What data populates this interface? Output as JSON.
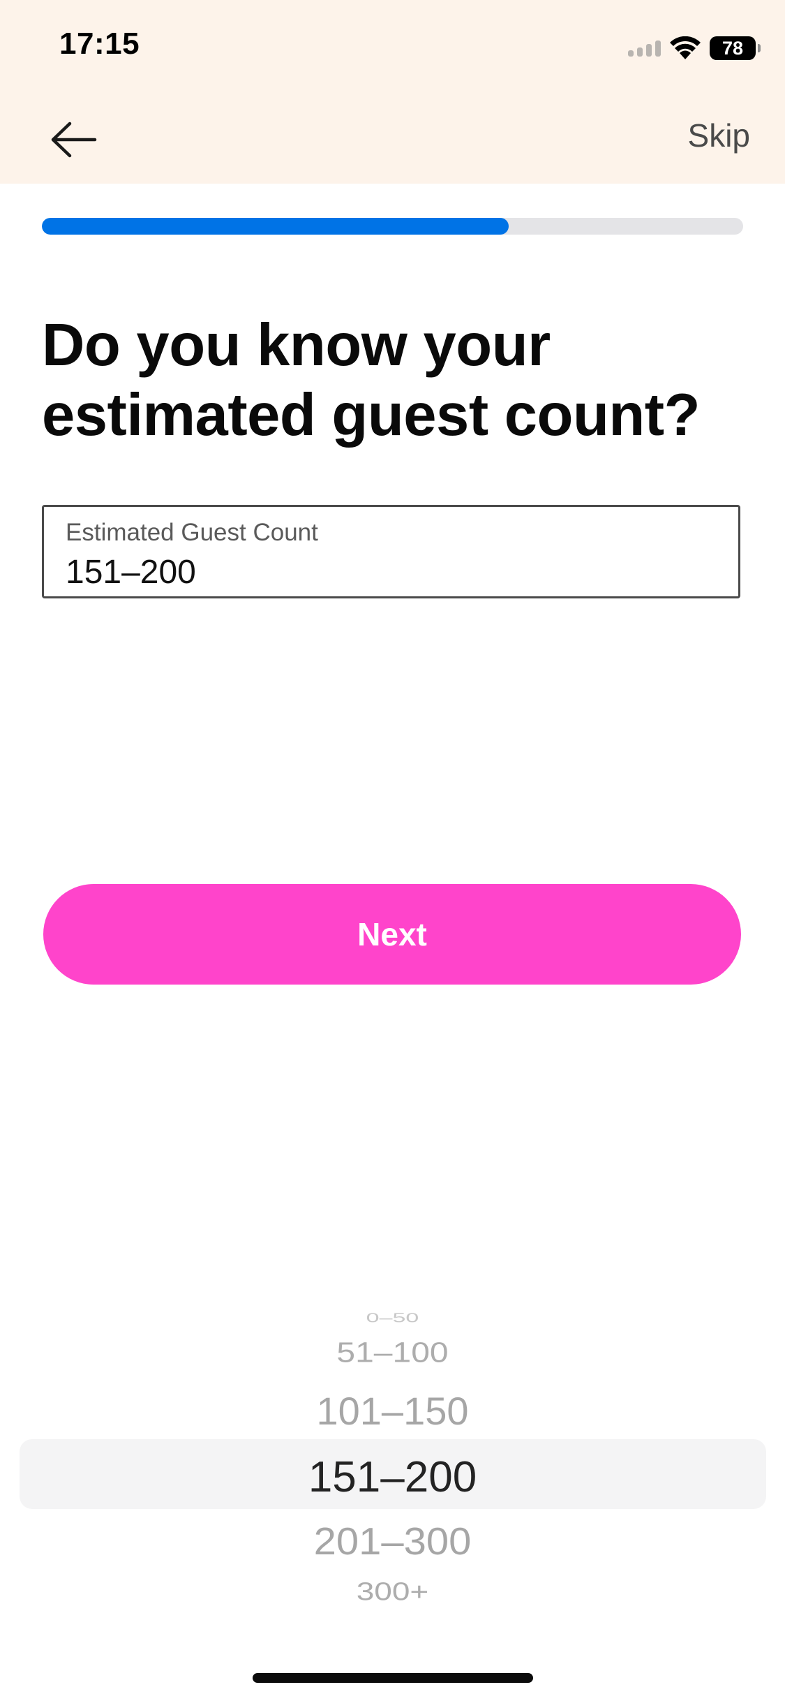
{
  "status_bar": {
    "time": "17:15",
    "battery": "78",
    "icons": [
      "cellular-signal-icon",
      "wifi-icon",
      "battery-icon"
    ]
  },
  "nav": {
    "back_icon": "arrow-left-icon",
    "skip_label": "Skip"
  },
  "progress": {
    "fraction": 0.666,
    "fill_color": "#0073e6",
    "track_color": "#e4e4e7"
  },
  "question": {
    "title": "Do you know your estimated guest count?"
  },
  "guest_count_field": {
    "label": "Estimated Guest Count",
    "value": "151–200"
  },
  "next_button": {
    "label": "Next",
    "color": "#ff44cb"
  },
  "picker": {
    "options": [
      "0–50",
      "51–100",
      "101–150",
      "151–200",
      "201–300",
      "300+"
    ],
    "selected": "151–200"
  }
}
